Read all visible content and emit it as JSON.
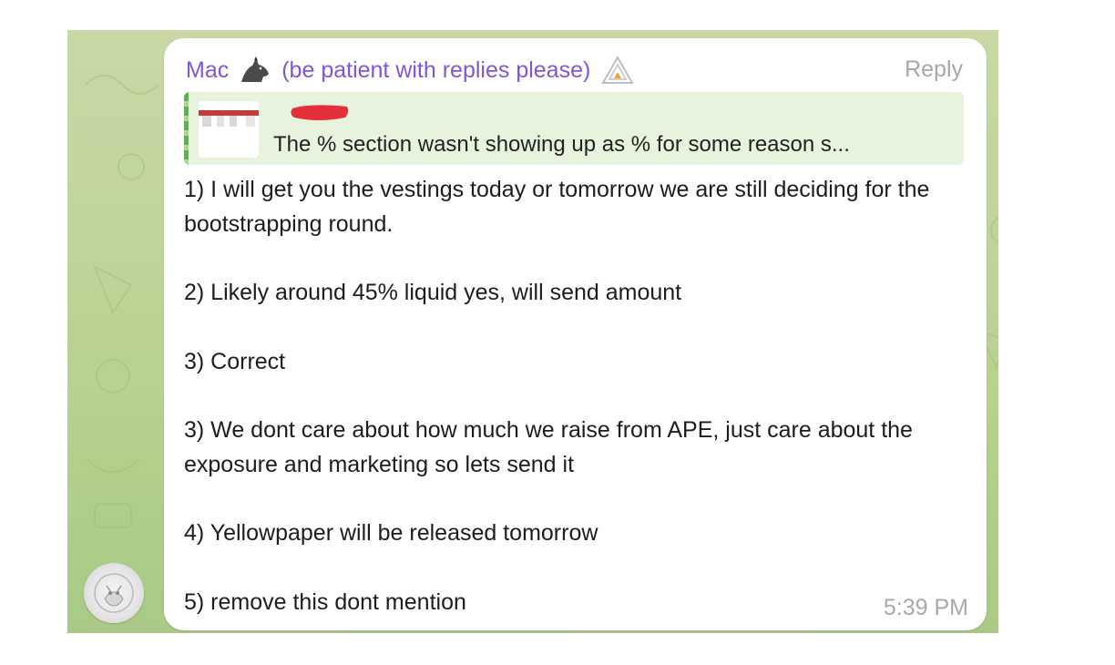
{
  "message": {
    "sender_name": "Mac",
    "sender_suffix": "(be patient with replies please)",
    "reply_label": "Reply",
    "quoted": {
      "text": "The % section wasn't showing up as % for some reason s..."
    },
    "lines": [
      "1) I will get you the vestings today or tomorrow we are still deciding for the bootstrapping round.",
      "2) Likely around 45% liquid yes, will send amount",
      "3) Correct",
      "3) We dont care about how much we raise from APE, just care about the exposure and marketing so lets send it",
      "4) Yellowpaper will be released tomorrow",
      "5) remove this dont mention"
    ],
    "time": "5:39 PM"
  },
  "icons": {
    "sender_emoji": "wolf-icon",
    "sender_badge": "ape-logo-icon",
    "avatar": "avatar-image"
  },
  "colors": {
    "sender": "#7f56d9",
    "quote_bg": "#e7f3dc",
    "quote_bar": "#59b24a",
    "chat_bg": "#bfd59a",
    "redaction": "#e5303a"
  }
}
